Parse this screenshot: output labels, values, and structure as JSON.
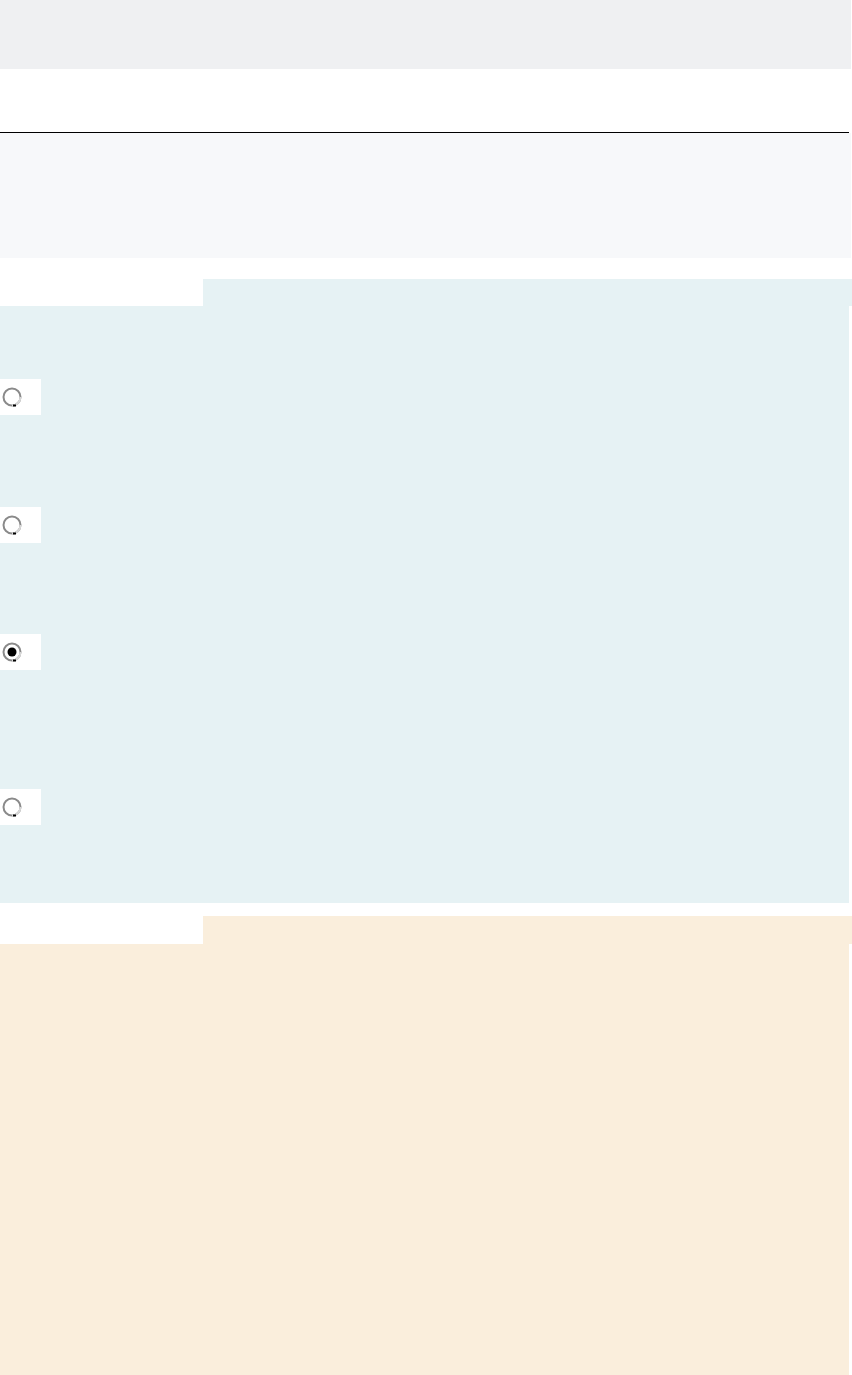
{
  "options": [
    {
      "selected": false
    },
    {
      "selected": false
    },
    {
      "selected": true
    },
    {
      "selected": false
    }
  ]
}
